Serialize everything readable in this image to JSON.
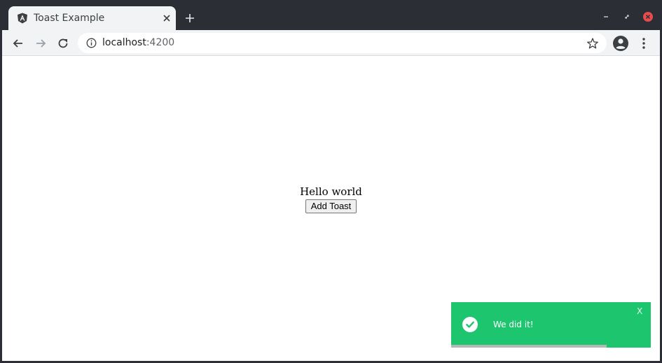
{
  "browser": {
    "tab": {
      "title": "Toast Example",
      "favicon": "angular-logo-icon"
    },
    "window_controls": [
      "minimize-icon",
      "restore-icon",
      "close-icon"
    ],
    "address_bar": {
      "host": "localhost",
      "port": ":4200"
    },
    "icons": {
      "back": "back-arrow-icon",
      "forward": "forward-arrow-icon",
      "reload": "reload-icon",
      "info": "info-icon",
      "bookmark": "star-icon",
      "profile": "profile-icon",
      "menu": "kebab-menu-icon"
    }
  },
  "page": {
    "heading": "Hello world",
    "add_toast_label": "Add Toast"
  },
  "toast": {
    "message": "We did it!",
    "close_label": "X",
    "progress": 0.78,
    "colors": {
      "background": "#1ec56f",
      "progress": "#b3b8b5"
    },
    "icon": "check-circle-icon"
  },
  "colors": {
    "chrome_dark": "#2b2e35",
    "toolbar": "#f1f3f4",
    "close_red": "#e84c4c"
  }
}
